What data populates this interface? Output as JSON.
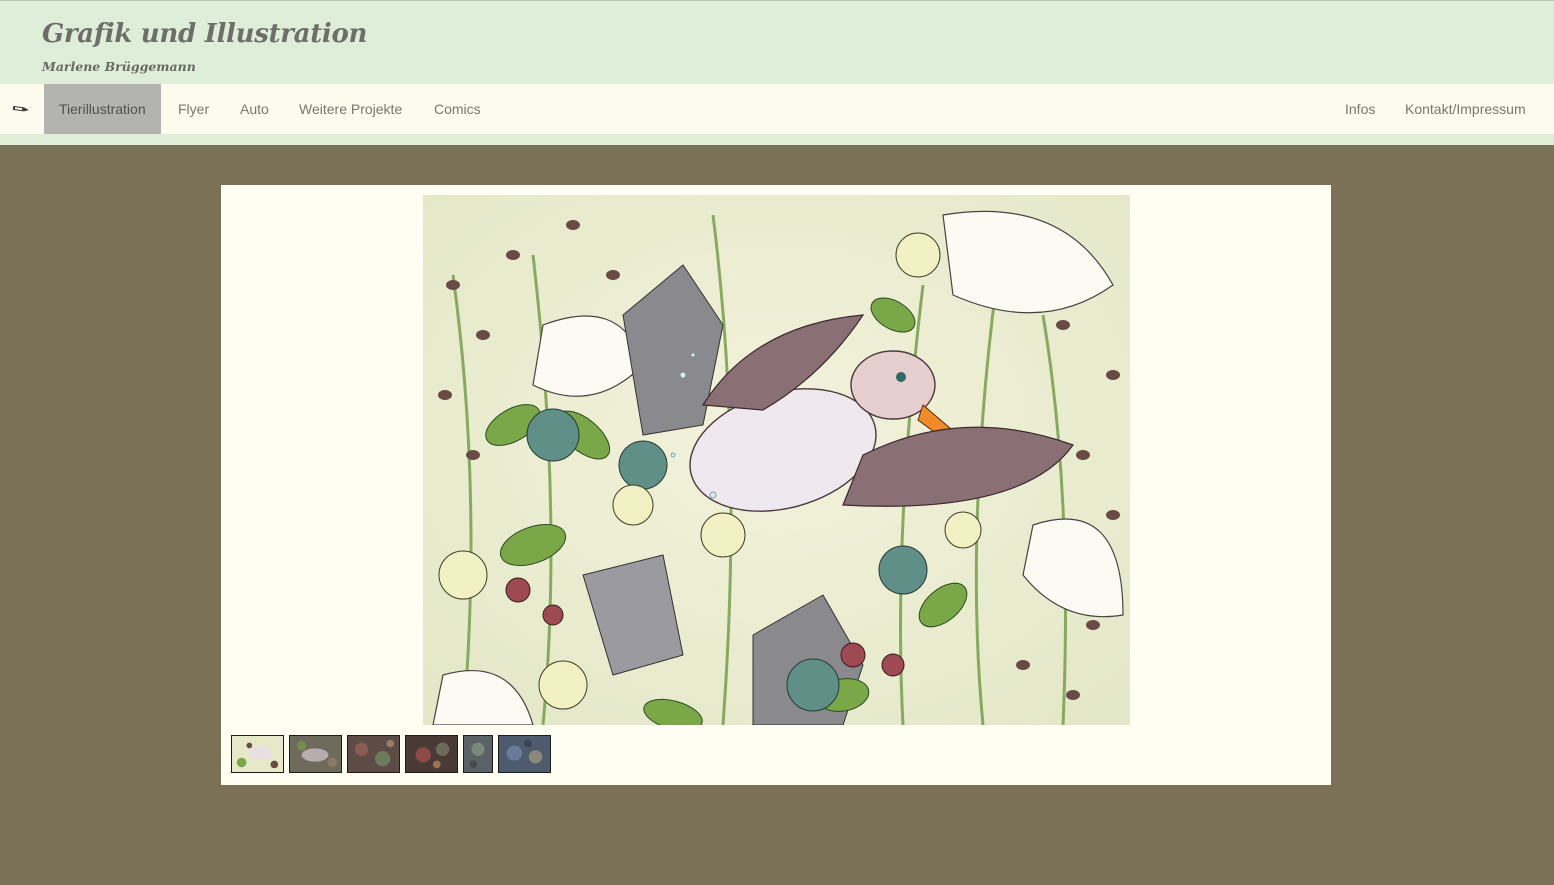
{
  "header": {
    "title": "Grafik und Illustration",
    "subtitle": "Marlene Brüggemann"
  },
  "nav": {
    "left_items": [
      {
        "label": "Tierillustration",
        "active": true
      },
      {
        "label": "Flyer",
        "active": false
      },
      {
        "label": "Auto",
        "active": false
      },
      {
        "label": "Weitere Projekte",
        "active": false
      },
      {
        "label": "Comics",
        "active": false
      }
    ],
    "right_items": [
      {
        "label": "Infos"
      },
      {
        "label": "Kontakt/Impressum"
      }
    ],
    "menu_icon": "pencil-icon"
  },
  "gallery": {
    "main_image_subject": "duck-among-flowers-illustration",
    "thumbnail_count": 6,
    "selected_thumbnail": 1
  },
  "colors": {
    "page_background": "#7b7156",
    "header_background": "#dfeed9",
    "nav_background": "#fdfbed",
    "active_nav_background": "#b3b3b0",
    "panel_background": "#fefef2"
  }
}
